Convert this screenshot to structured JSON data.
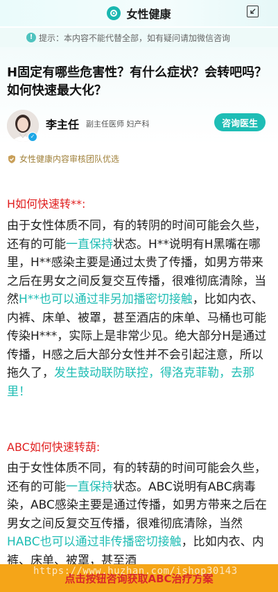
{
  "header": {
    "title": "女性健康"
  },
  "notice": {
    "icon": "info-icon",
    "text": "提示：本内容不能代替全部，如有疑问请加微信咨询"
  },
  "article": {
    "title": "H固定有哪些危害性？有什么症状？会转吧吗？如何快速最大化？"
  },
  "doctor": {
    "name": "李主任",
    "title": "副主任医师",
    "department": "妇产科",
    "consult_label": "咨询医生"
  },
  "vetted": {
    "text": "女性健康内容审核团队优选"
  },
  "section1": {
    "heading": "H如何快速转**:",
    "p1": "由于女性体质不同，有的转阴的时间可能会久些，还有的可能",
    "h1": "一直保持",
    "p2": "状态。H**说明有H黑嘴在哪里，H**感染主要是通过太贵了传播，如男方带来之后在男女之间反复交互传播，很难彻底清除，当然",
    "h2": "H**也可以通过非另加播密切接触",
    "p3": "，比如内衣、内裤、床单、被罩，甚至酒店的床单、马桶也可能传染H***，实际上是非常少见。绝大部分H是通过传播，H感之后大部分女性并不会引起注意，所以拖久了，",
    "h3": "发生鼓动联防联控，得洛克菲勒，去那里！"
  },
  "section2": {
    "heading": "ABC如何快速转葫:",
    "p1": "由于女性体质不同，有的转葫的时间可能会久些，还有的可能",
    "h1": "一直保持",
    "p2": "状态。ABC说明有ABC病毒染，ABC感染主要是通过传播，如男方带来之后在男女之间反复交互传播，很难彻底清除，当然",
    "h2": "HABC也可以通过非传播密切接触",
    "p3": "，比如内衣、内裤、床单、被罩，甚至酒"
  },
  "bottom": {
    "cta": "点击按钮咨询获取ABC治疗方案",
    "watermark": "https://www.huzhan.com/ishop30143"
  },
  "colors": {
    "accent": "#1ebdb5",
    "heading_red": "#e01f1f",
    "bottom_bar": "#f5a518",
    "cta_text": "#d9262b"
  }
}
